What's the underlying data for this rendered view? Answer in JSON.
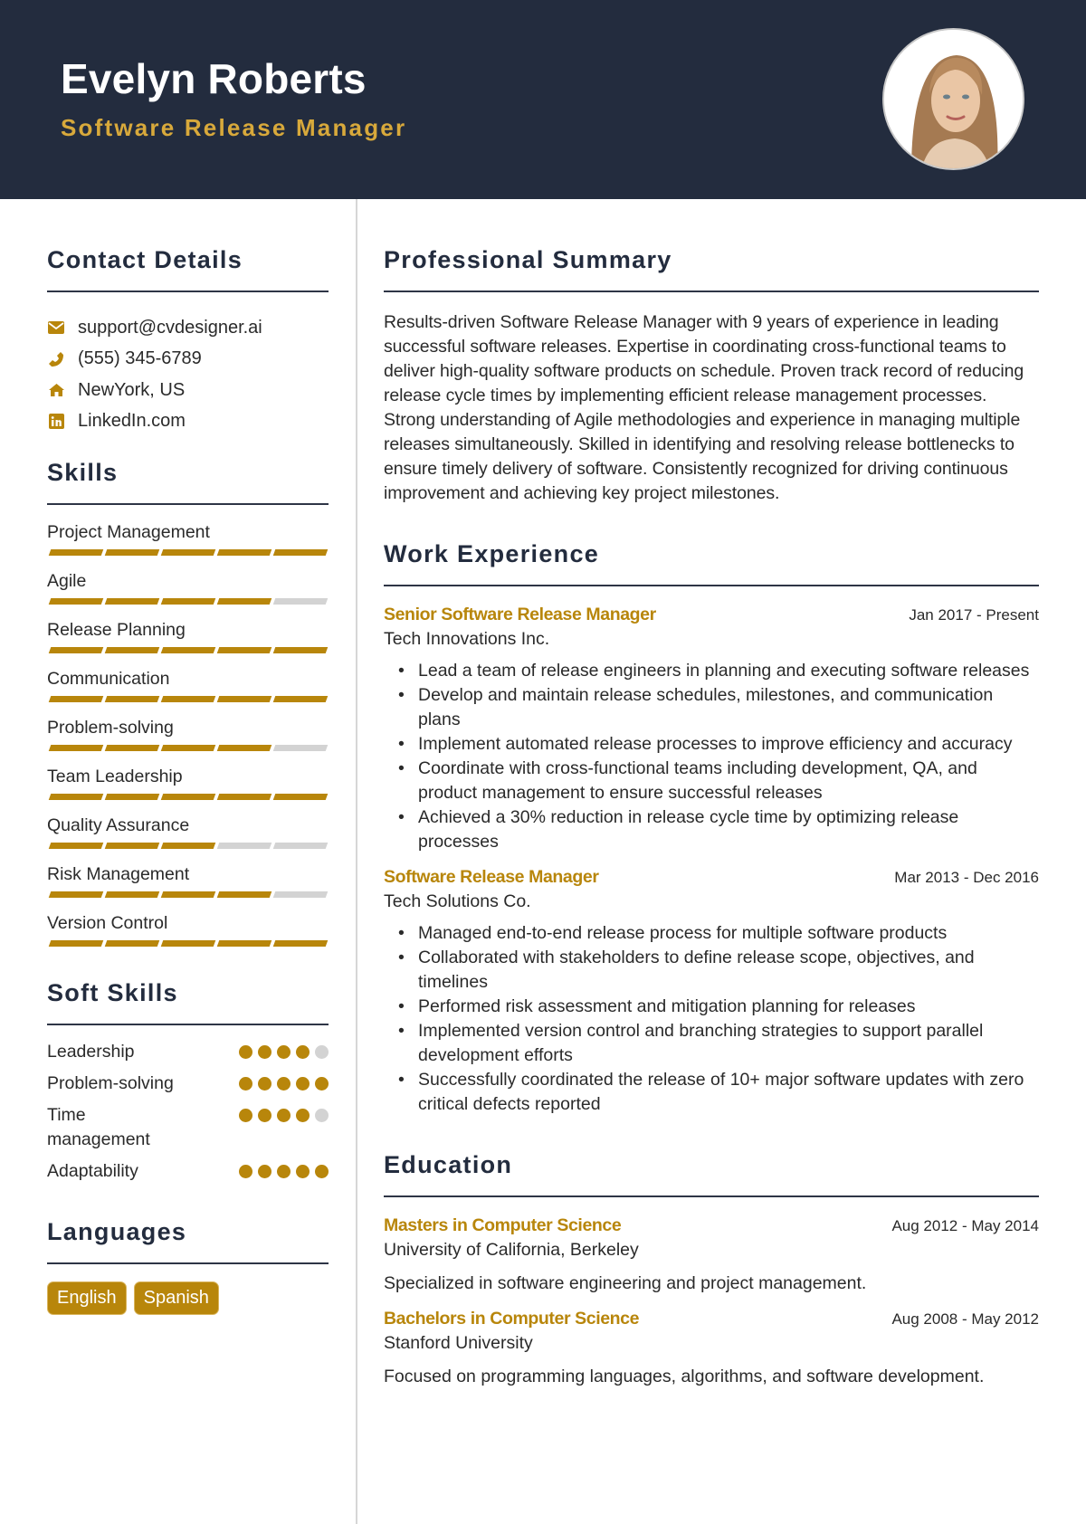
{
  "header": {
    "name": "Evelyn Roberts",
    "role": "Software Release Manager",
    "photo_alt": "Profile photo of Evelyn Roberts"
  },
  "colors": {
    "header_bg": "#232c3e",
    "accent": "#b8860b",
    "role_text": "#d8a93b",
    "inactive": "#d3d3d3"
  },
  "contact": {
    "title": "Contact Details",
    "items": [
      {
        "icon": "envelope-icon",
        "text": "support@cvdesigner.ai"
      },
      {
        "icon": "phone-icon",
        "text": "(555) 345-6789"
      },
      {
        "icon": "home-icon",
        "text": "NewYork, US"
      },
      {
        "icon": "linkedin-icon",
        "text": "LinkedIn.com"
      }
    ]
  },
  "skills": {
    "title": "Skills",
    "max": 5,
    "items": [
      {
        "name": "Project Management",
        "level": 5
      },
      {
        "name": "Agile",
        "level": 4
      },
      {
        "name": "Release Planning",
        "level": 5
      },
      {
        "name": "Communication",
        "level": 5
      },
      {
        "name": "Problem-solving",
        "level": 4
      },
      {
        "name": "Team Leadership",
        "level": 5
      },
      {
        "name": "Quality Assurance",
        "level": 3
      },
      {
        "name": "Risk Management",
        "level": 4
      },
      {
        "name": "Version Control",
        "level": 5
      }
    ]
  },
  "soft_skills": {
    "title": "Soft Skills",
    "max": 5,
    "items": [
      {
        "name": "Leadership",
        "level": 4
      },
      {
        "name": "Problem-solving",
        "level": 5
      },
      {
        "name": "Time management",
        "level": 4
      },
      {
        "name": "Adaptability",
        "level": 5
      }
    ]
  },
  "languages": {
    "title": "Languages",
    "items": [
      "English",
      "Spanish"
    ]
  },
  "summary": {
    "title": "Professional Summary",
    "text": "Results-driven Software Release Manager with 9 years of experience in leading successful software releases. Expertise in coordinating cross-functional teams to deliver high-quality software products on schedule. Proven track record of reducing release cycle times by implementing efficient release management processes. Strong understanding of Agile methodologies and experience in managing multiple releases simultaneously. Skilled in identifying and resolving release bottlenecks to ensure timely delivery of software. Consistently recognized for driving continuous improvement and achieving key project milestones."
  },
  "experience": {
    "title": "Work Experience",
    "jobs": [
      {
        "title": "Senior Software Release Manager",
        "date": "Jan 2017 - Present",
        "company": "Tech Innovations Inc.",
        "bullets": [
          "Lead a team of release engineers in planning and executing software releases",
          "Develop and maintain release schedules, milestones, and communication plans",
          "Implement automated release processes to improve efficiency and accuracy",
          "Coordinate with cross-functional teams including development, QA, and product management to ensure successful releases",
          "Achieved a 30% reduction in release cycle time by optimizing release processes"
        ]
      },
      {
        "title": "Software Release Manager",
        "date": "Mar 2013 - Dec 2016",
        "company": "Tech Solutions Co.",
        "bullets": [
          "Managed end-to-end release process for multiple software products",
          "Collaborated with stakeholders to define release scope, objectives, and timelines",
          "Performed risk assessment and mitigation planning for releases",
          "Implemented version control and branching strategies to support parallel development efforts",
          "Successfully coordinated the release of 10+ major software updates with zero critical defects reported"
        ]
      }
    ]
  },
  "education": {
    "title": "Education",
    "items": [
      {
        "degree": "Masters in Computer Science",
        "date": "Aug 2012 - May 2014",
        "school": "University of California, Berkeley",
        "description": "Specialized in software engineering and project management."
      },
      {
        "degree": "Bachelors in Computer Science",
        "date": "Aug 2008 - May 2012",
        "school": "Stanford University",
        "description": "Focused on programming languages, algorithms, and software development."
      }
    ]
  }
}
